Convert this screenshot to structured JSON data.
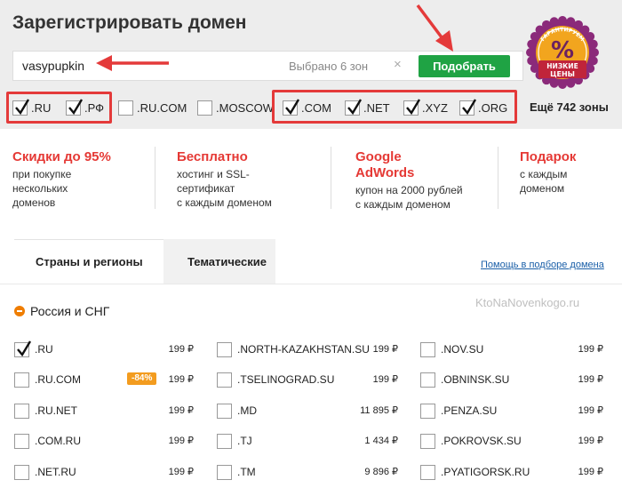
{
  "header": {
    "title": "Зарегистрировать домен"
  },
  "search": {
    "value": "vasypupkin",
    "selected_count": "Выбрано 6 зон",
    "clear_symbol": "×",
    "pick_label": "Подобрать"
  },
  "badge": {
    "top_text": "ГАРАНТИРУЕМ",
    "symbol": "%",
    "line1": "НИЗКИЕ",
    "line2": "ЦЕНЫ",
    "colors": {
      "outer": "#8b2a7a",
      "inner": "#f2a51e",
      "ribbon": "#c0243a"
    }
  },
  "zones": {
    "items": [
      {
        "label": ".RU",
        "checked": true
      },
      {
        "label": ".РФ",
        "checked": true
      },
      {
        "label": ".RU.COM",
        "checked": false
      },
      {
        "label": ".MOSCOW",
        "checked": false
      },
      {
        "label": ".COM",
        "checked": true
      },
      {
        "label": ".NET",
        "checked": true
      },
      {
        "label": ".XYZ",
        "checked": true
      },
      {
        "label": ".ORG",
        "checked": true
      }
    ],
    "more": "Ещё 742 зоны"
  },
  "promos": [
    {
      "title": "Скидки до 95%",
      "lines": [
        "при покупке",
        "нескольких",
        "доменов"
      ]
    },
    {
      "title": "Бесплатно",
      "lines": [
        "хостинг и SSL-",
        "сертификат",
        "с каждым доменом"
      ]
    },
    {
      "title_lines": [
        "Google",
        "AdWords"
      ],
      "lines": [
        "купон на 2000 рублей",
        "с каждым доменом"
      ]
    },
    {
      "title": "Подарок",
      "lines": [
        "с каждым",
        "доменом"
      ]
    }
  ],
  "tabs": {
    "items": [
      "Страны и регионы",
      "Тематические"
    ],
    "active": "Страны и регионы",
    "help": "Помощь в подборе домена"
  },
  "watermark": "KtoNaNovenkogo.ru",
  "region": {
    "label": "Россия и СНГ"
  },
  "domains": {
    "col1": [
      {
        "name": ".RU",
        "price": "199 ₽",
        "checked": true
      },
      {
        "name": ".RU.COM",
        "price": "199 ₽",
        "checked": false,
        "discount": "-84%"
      },
      {
        "name": ".RU.NET",
        "price": "199 ₽",
        "checked": false
      },
      {
        "name": ".COM.RU",
        "price": "199 ₽",
        "checked": false
      },
      {
        "name": ".NET.RU",
        "price": "199 ₽",
        "checked": false
      }
    ],
    "col2": [
      {
        "name": ".NORTH-KAZAKHSTAN.SU",
        "price": "199 ₽",
        "checked": false
      },
      {
        "name": ".TSELINOGRAD.SU",
        "price": "199 ₽",
        "checked": false
      },
      {
        "name": ".MD",
        "price": "11 895 ₽",
        "checked": false
      },
      {
        "name": ".TJ",
        "price": "1 434 ₽",
        "checked": false
      },
      {
        "name": ".TM",
        "price": "9 896 ₽",
        "checked": false
      }
    ],
    "col3": [
      {
        "name": ".NOV.SU",
        "price": "199 ₽",
        "checked": false
      },
      {
        "name": ".OBNINSK.SU",
        "price": "199 ₽",
        "checked": false
      },
      {
        "name": ".PENZA.SU",
        "price": "199 ₽",
        "checked": false
      },
      {
        "name": ".POKROVSK.SU",
        "price": "199 ₽",
        "checked": false
      },
      {
        "name": ".PYATIGORSK.RU",
        "price": "199 ₽",
        "checked": false
      }
    ]
  },
  "colors": {
    "accent_red": "#e53935",
    "button_green": "#1fa344",
    "annotation_red": "#e43a3a",
    "link_blue": "#1a5fa8",
    "discount_orange": "#f39c1f"
  }
}
